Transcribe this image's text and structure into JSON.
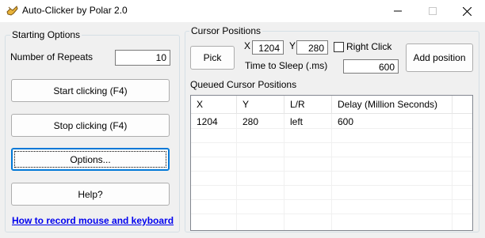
{
  "window": {
    "title": "Auto-Clicker by Polar 2.0",
    "icon": "cursor-hand-icon",
    "controls": {
      "minimize": "minimize-icon",
      "maximize": "maximize-icon",
      "close": "close-icon"
    }
  },
  "starting_options": {
    "group_label": "Starting Options",
    "repeats_label": "Number of Repeats",
    "repeats_value": "10",
    "start_button": "Start clicking (F4)",
    "stop_button": "Stop clicking (F4)",
    "options_button": "Options...",
    "help_button": "Help?",
    "help_link": "How to record mouse and keyboard"
  },
  "cursor_positions": {
    "group_label": "Cursor Positions",
    "pick_button": "Pick",
    "x_label": "X",
    "x_value": "1204",
    "y_label": "Y",
    "y_value": "280",
    "right_click_label": "Right Click",
    "right_click_checked": false,
    "sleep_label": "Time to Sleep (.ms)",
    "sleep_value": "600",
    "add_button": "Add position"
  },
  "queue": {
    "label": "Queued Cursor Positions",
    "columns": [
      "X",
      "Y",
      "L/R",
      "Delay (Million Seconds)"
    ],
    "rows": [
      [
        "1204",
        "280",
        "left",
        "600"
      ]
    ]
  },
  "colors": {
    "window_bg": "#f0f0f0",
    "focus_accent": "#0078d7",
    "link": "#0000ee"
  }
}
